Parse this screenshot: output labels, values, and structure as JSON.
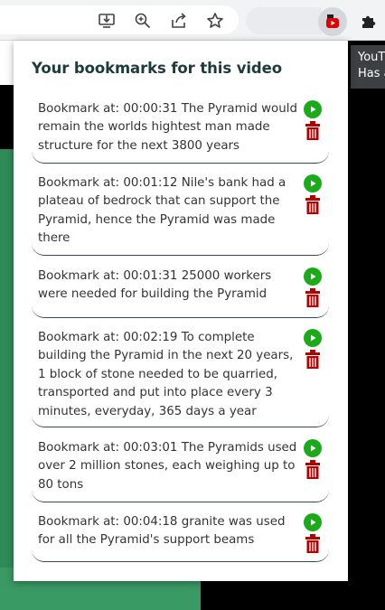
{
  "colors": {
    "accent_green": "#1aaa1a",
    "delete_red": "#b00000",
    "title_color": "#1d3b3b"
  },
  "toolbar": {
    "icons": [
      "install-app-icon",
      "zoom-icon",
      "share-icon",
      "bookmark-star-icon",
      "youtube-bookmarker-extension-icon",
      "extensions-puzzle-icon"
    ]
  },
  "tooltip": {
    "line1": "YouT",
    "line2": "Has a"
  },
  "popup": {
    "title": "Your bookmarks for this video",
    "bookmarks": [
      {
        "text": "Bookmark at: 00:00:31 The Pyramid would remain the worlds hightest man made structure for the next 3800 years"
      },
      {
        "text": "Bookmark at: 00:01:12 Nile's bank had a plateau of bedrock that can support the Pyramid, hence the Pyramid was made there"
      },
      {
        "text": "Bookmark at: 00:01:31 25000 workers were needed for building the Pyramid"
      },
      {
        "text": "Bookmark at: 00:02:19 To complete building the Pyramid in the next 20 years, 1 block of stone needed to be quarried, transported and put into place every 3 minutes, everyday, 365 days a year"
      },
      {
        "text": "Bookmark at: 00:03:01 The Pyramids used over 2 million stones, each weighing up to 80 tons"
      },
      {
        "text": "Bookmark at: 00:04:18 granite was used for all the Pyramid's support beams"
      }
    ]
  }
}
